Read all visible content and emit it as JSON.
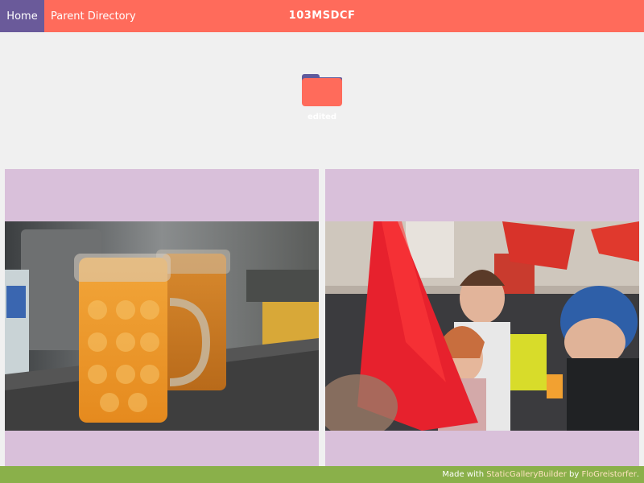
{
  "header": {
    "home_label": "Home",
    "parent_label": "Parent Directory",
    "title": "103MSDCF"
  },
  "folders": [
    {
      "label": "edited",
      "icon": "folder-icon"
    }
  ],
  "gallery": {
    "items": [
      {
        "icon": "photo-beer-mugs"
      },
      {
        "icon": "photo-demonstration"
      }
    ]
  },
  "footer": {
    "made_with": "Made with ",
    "builder_link": "StaticGalleryBuilder",
    "by": " by ",
    "author_link": "FloGreistorfer",
    "period": "."
  },
  "colors": {
    "header_bg": "#ff6b5b",
    "home_bg": "#6a5a9a",
    "card_bg": "#d9c0da",
    "footer_bg": "#8ab04a",
    "page_bg": "#f0f0f0"
  }
}
